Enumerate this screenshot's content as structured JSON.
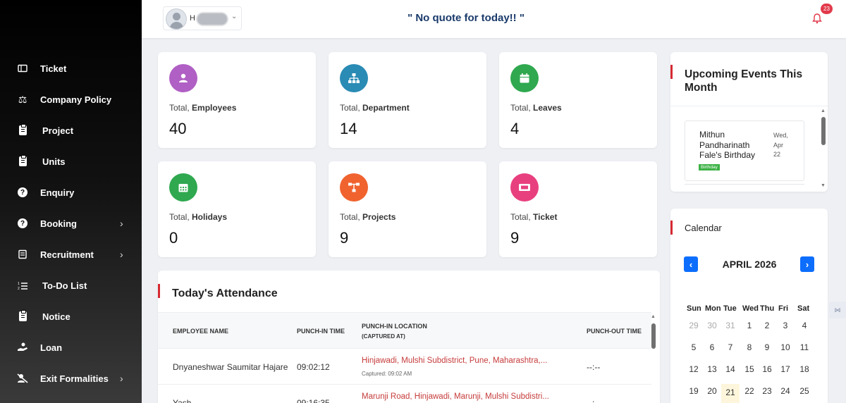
{
  "sidebar": {
    "items": [
      {
        "label": "Ticket",
        "icon": "ticket-icon",
        "submenu": false
      },
      {
        "label": "Company Policy",
        "icon": "policy-icon",
        "submenu": false
      },
      {
        "label": "Project",
        "icon": "clipboard-icon",
        "submenu": false
      },
      {
        "label": "Units",
        "icon": "clipboard-icon",
        "submenu": false
      },
      {
        "label": "Enquiry",
        "icon": "question-icon",
        "submenu": false
      },
      {
        "label": "Booking",
        "icon": "question-icon",
        "submenu": true
      },
      {
        "label": "Recruitment",
        "icon": "recruitment-icon",
        "submenu": true
      },
      {
        "label": "To-Do List",
        "icon": "list-icon",
        "submenu": false
      },
      {
        "label": "Notice",
        "icon": "clipboard-icon",
        "submenu": false
      },
      {
        "label": "Loan",
        "icon": "loan-icon",
        "submenu": false
      },
      {
        "label": "Exit Formalities",
        "icon": "exit-icon",
        "submenu": true
      }
    ],
    "chevron": "›"
  },
  "header": {
    "user_initial": "H",
    "quote": "\" No quote for today!! \"",
    "notification_count": "23"
  },
  "stats": [
    {
      "prefix": "Total,",
      "label": "Employees",
      "value": "40",
      "color": "#b05fc4",
      "icon": "users-icon"
    },
    {
      "prefix": "Total,",
      "label": "Department",
      "value": "14",
      "color": "#2a8bb5",
      "icon": "org-chart-icon"
    },
    {
      "prefix": "Total,",
      "label": "Leaves",
      "value": "4",
      "color": "#2fa84f",
      "icon": "calendar-icon"
    },
    {
      "prefix": "Total,",
      "label": "Holidays",
      "value": "0",
      "color": "#2fa84f",
      "icon": "calendar-grid-icon"
    },
    {
      "prefix": "Total,",
      "label": "Projects",
      "value": "9",
      "color": "#f0632f",
      "icon": "project-icon"
    },
    {
      "prefix": "Total,",
      "label": "Ticket",
      "value": "9",
      "color": "#e8407f",
      "icon": "ticket-icon"
    }
  ],
  "attendance": {
    "title": "Today's Attendance",
    "columns": {
      "name": "EMPLOYEE NAME",
      "punch_in": "PUNCH-IN TIME",
      "location": "PUNCH-IN LOCATION",
      "location_sub": "(CAPTURED AT)",
      "punch_out": "PUNCH-OUT TIME"
    },
    "rows": [
      {
        "name": "Dnyaneshwar Saumitar Hajare",
        "punch_in": "09:02:12",
        "location": "Hinjawadi, Mulshi Subdistrict, Pune, Maharashtra,...",
        "captured": "Captured: 09:02 AM",
        "punch_out": "--:--"
      },
      {
        "name": "Yash",
        "punch_in": "09:16:35",
        "location": "Marunji Road, Hinjawadi, Marunji, Mulshi Subdistri...",
        "captured": "",
        "punch_out": "--:--"
      }
    ]
  },
  "events": {
    "title": "Upcoming Events This Month",
    "items": [
      {
        "name": "Mithun Pandharinath Fale's Birthday",
        "weekday": "Wed,",
        "month": "Apr",
        "day": "22",
        "badge": "Birthday"
      }
    ]
  },
  "calendar": {
    "title": "Calendar",
    "month_label": "APRIL 2026",
    "prev": "‹",
    "next": "›",
    "weekdays": [
      "Sun",
      "Mon",
      "Tue",
      "Wed",
      "Thu",
      "Fri",
      "Sat"
    ],
    "weeks": [
      [
        "29",
        "30",
        "31",
        "1",
        "2",
        "3",
        "4"
      ],
      [
        "5",
        "6",
        "7",
        "8",
        "9",
        "10",
        "11"
      ],
      [
        "12",
        "13",
        "14",
        "15",
        "16",
        "17",
        "18"
      ],
      [
        "19",
        "20",
        "21",
        "22",
        "23",
        "24",
        "25"
      ]
    ],
    "muted_first_week": 3,
    "today": "21",
    "accent": "#0d6efd"
  },
  "colors": {
    "accent_red": "#d62a32",
    "quote": "#1a3a6b"
  }
}
